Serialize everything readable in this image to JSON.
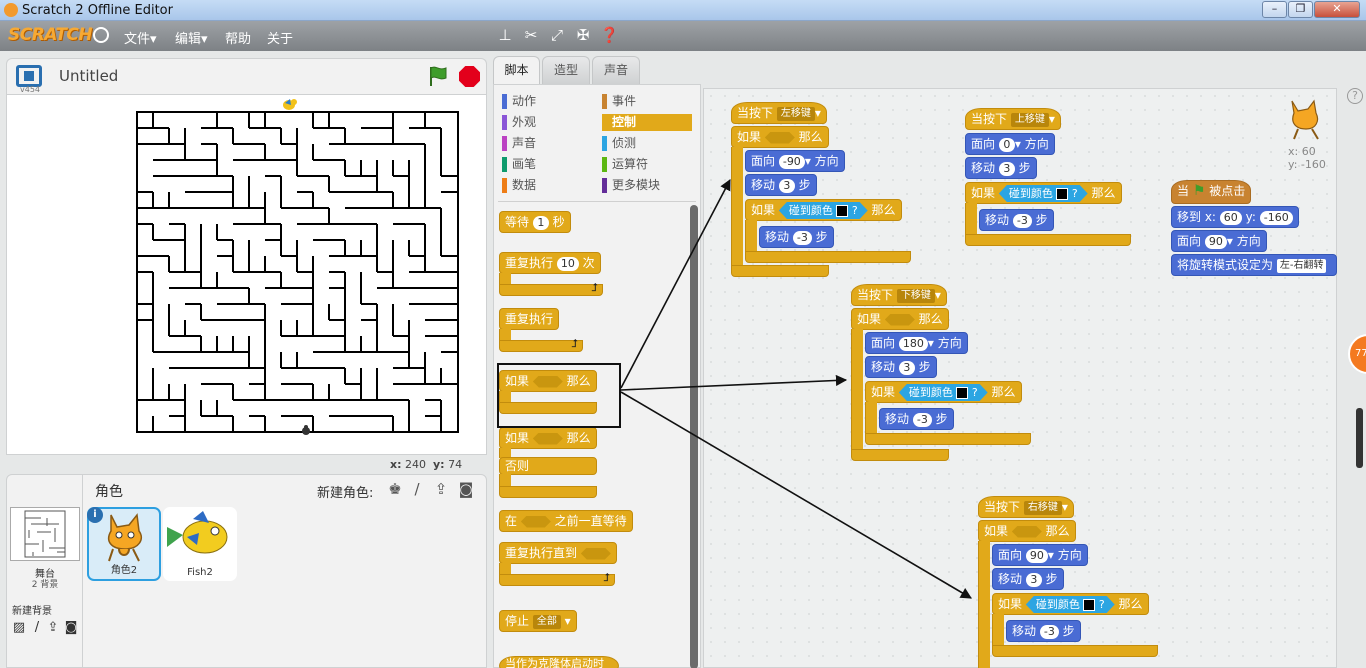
{
  "window": {
    "title": "Scratch 2 Offline Editor"
  },
  "menu": {
    "logo": "SCRATCH",
    "file": "文件▾",
    "edit": "编辑▾",
    "help": "帮助",
    "about": "关于"
  },
  "stage": {
    "version": "v454",
    "title": "Untitled",
    "x_label": "x:",
    "x": "240",
    "y_label": "y:",
    "y": "74"
  },
  "sprites": {
    "header": "角色",
    "new_sprite": "新建角色:",
    "stage_label": "舞台",
    "stage_backdrops": "2 背景",
    "new_backdrop": "新建背景",
    "items": [
      {
        "name": "角色2"
      },
      {
        "name": "Fish2"
      }
    ]
  },
  "tabs": {
    "scripts": "脚本",
    "costumes": "造型",
    "sounds": "声音"
  },
  "categories": [
    {
      "label": "动作",
      "color": "#4a6cd4"
    },
    {
      "label": "事件",
      "color": "#c88330"
    },
    {
      "label": "外观",
      "color": "#8a55d7"
    },
    {
      "label": "控制",
      "color": "#e1a91a"
    },
    {
      "label": "声音",
      "color": "#bb42c3"
    },
    {
      "label": "侦测",
      "color": "#2ca5e2"
    },
    {
      "label": "画笔",
      "color": "#0e9a6c"
    },
    {
      "label": "运算符",
      "color": "#5cb712"
    },
    {
      "label": "数据",
      "color": "#ee7d16"
    },
    {
      "label": "更多模块",
      "color": "#632d99"
    }
  ],
  "palette": {
    "wait": "等待",
    "wait_val": "1",
    "wait_unit": "秒",
    "repeat": "重复执行",
    "repeat_val": "10",
    "repeat_unit": "次",
    "forever": "重复执行",
    "if": "如果",
    "then": "那么",
    "if2": "如果",
    "then2": "那么",
    "else": "否则",
    "wait_until_pre": "在",
    "wait_until_post": "之前一直等待",
    "repeat_until": "重复执行直到",
    "stop": "停止",
    "stop_opt": "全部",
    "partial": "当作为克隆体启动时"
  },
  "sprite_info": {
    "x_label": "x:",
    "x": "60",
    "y_label": "y:",
    "y": "-160"
  },
  "scripts": {
    "left": {
      "hat": "当按下",
      "key": "左移键",
      "if": "如果",
      "then": "那么",
      "face": "面向",
      "dir": "-90",
      "dir_unit": "方向",
      "move": "移动",
      "steps": "3",
      "step_unit": "步",
      "touch": "碰到颜色",
      "q": "?",
      "back": "-3"
    },
    "up": {
      "hat": "当按下",
      "key": "上移键",
      "face": "面向",
      "dir": "0",
      "dir_unit": "方向",
      "move": "移动",
      "steps": "3",
      "step_unit": "步",
      "if": "碰到颜色",
      "then": "那么",
      "q": "?",
      "back": "-3"
    },
    "down": {
      "hat": "当按下",
      "key": "下移键",
      "if": "如果",
      "then": "那么",
      "face": "面向",
      "dir": "180",
      "dir_unit": "方向",
      "move": "移动",
      "steps": "3",
      "step_unit": "步",
      "touch": "碰到颜色",
      "q": "?",
      "back": "-3"
    },
    "right": {
      "hat": "当按下",
      "key": "右移键",
      "if": "如果",
      "then": "那么",
      "face": "面向",
      "dir": "90",
      "dir_unit": "方向",
      "move": "移动",
      "steps": "3",
      "step_unit": "步",
      "touch": "碰到颜色",
      "q": "?",
      "back": "-3"
    },
    "flag": {
      "when": "当",
      "clicked": "被点击",
      "goto": "移到 x:",
      "gx": "60",
      "gy_label": "y:",
      "gy": "-160",
      "face": "面向",
      "dir": "90",
      "dir_unit": "方向",
      "rot": "将旋转模式设定为",
      "rot_opt": "左-右翻转"
    }
  },
  "badge": "77"
}
